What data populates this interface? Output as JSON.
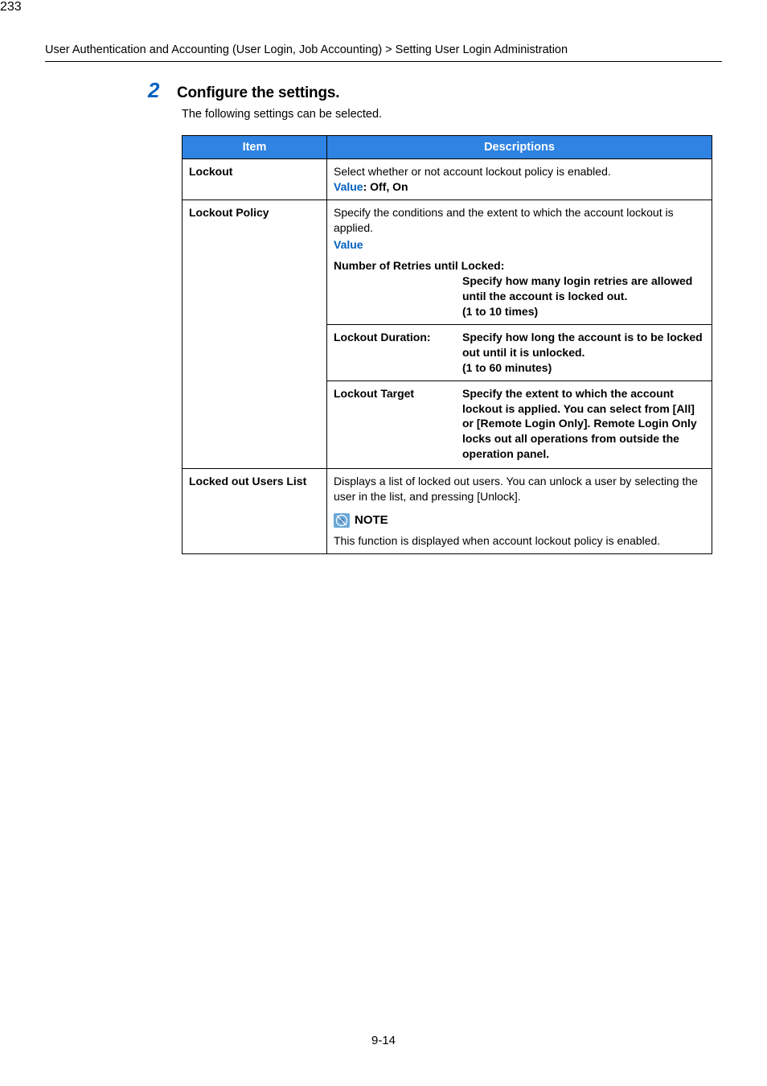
{
  "breadcrumb": "User Authentication and Accounting (User Login, Job Accounting) > Setting User Login Administration",
  "step": {
    "number": "2",
    "title": "Configure the settings.",
    "intro": "The following settings can be selected."
  },
  "table": {
    "head_item": "Item",
    "head_desc": "Descriptions",
    "rows": {
      "lockout": {
        "item": "Lockout",
        "desc": "Select whether or not account lockout policy is enabled.",
        "value_label": "Value",
        "value_options": ": Off, On"
      },
      "policy": {
        "item": "Lockout Policy",
        "desc": "Specify the conditions and the extent to which the account lockout is applied.",
        "value_label": "Value",
        "retries_label": "Number of Retries until Locked:",
        "retries_desc": "Specify how many login retries are allowed until the account is locked out.\n(1 to 10 times)",
        "duration_label": "Lockout Duration:",
        "duration_desc": "Specify how long the account is to be locked out until it is unlocked.\n(1 to 60 minutes)",
        "target_label": "Lockout Target",
        "target_desc": "Specify the extent to which the account lockout is applied. You can select from [All] or [Remote Login Only]. Remote Login Only locks out all operations from outside the operation panel."
      },
      "users": {
        "item": "Locked out Users List",
        "desc": "Displays a list of locked out users. You can unlock a user by selecting the user in the list, and pressing [Unlock].",
        "note_label": "NOTE",
        "note_text": "This function is displayed when account lockout policy is enabled."
      }
    }
  },
  "footer": "9-14"
}
